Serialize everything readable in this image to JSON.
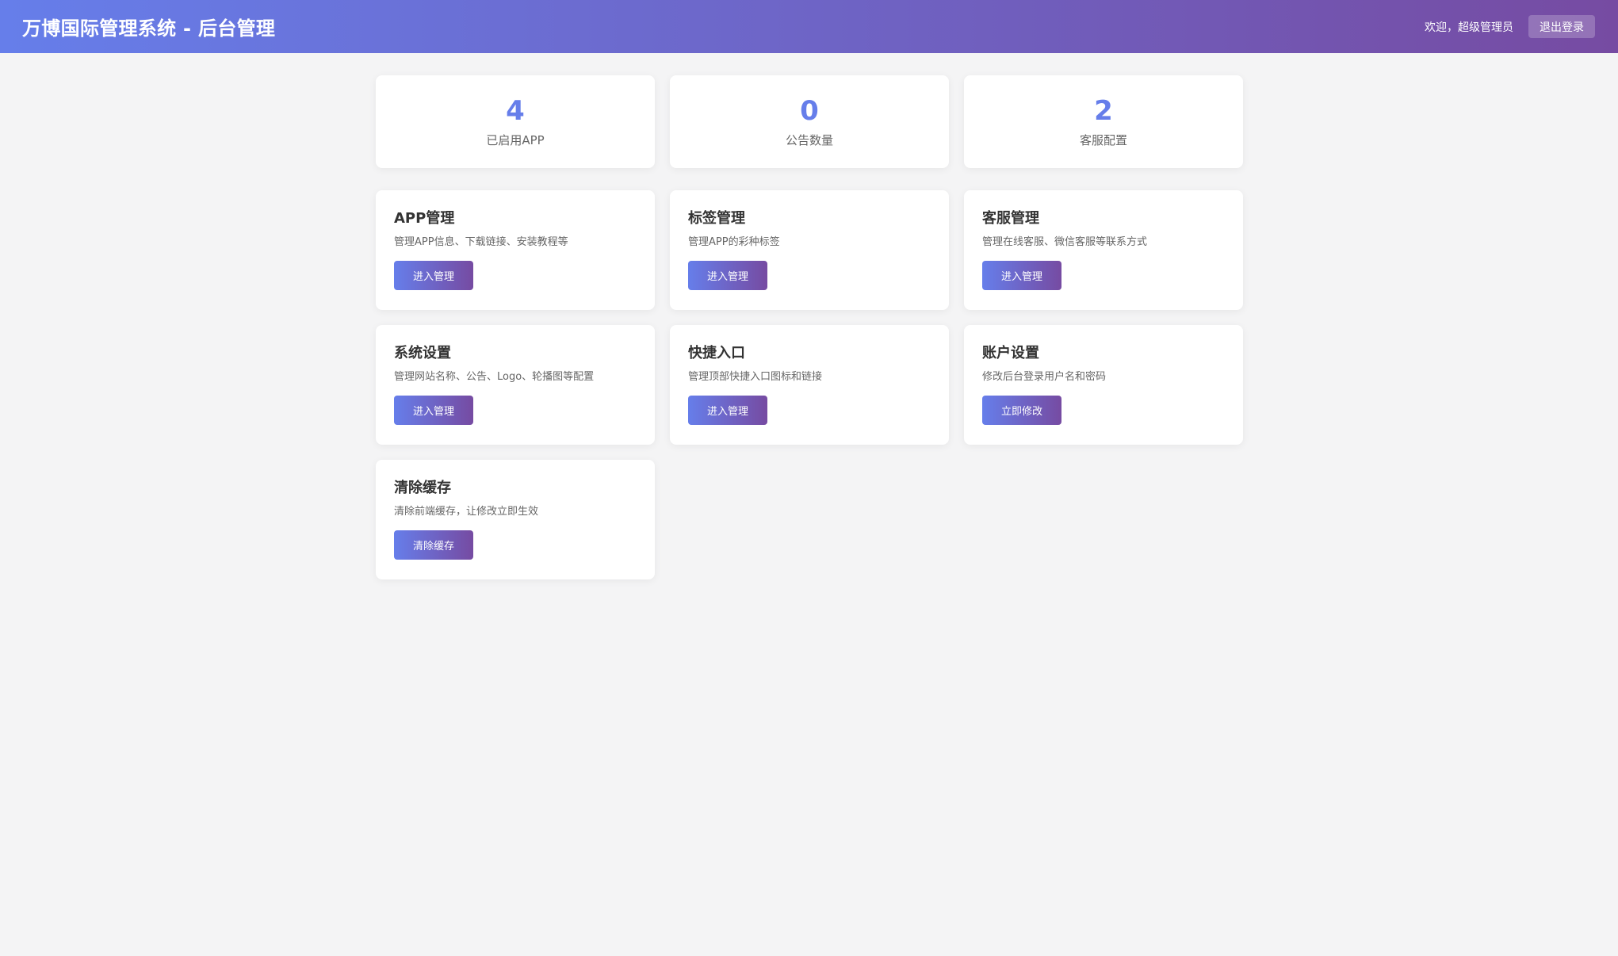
{
  "header": {
    "title": "万博国际管理系统 - 后台管理",
    "welcome": "欢迎，超级管理员",
    "logout_label": "退出登录"
  },
  "stats": [
    {
      "value": "4",
      "label": "已启用APP"
    },
    {
      "value": "0",
      "label": "公告数量"
    },
    {
      "value": "2",
      "label": "客服配置"
    }
  ],
  "modules": [
    {
      "title": "APP管理",
      "desc": "管理APP信息、下载链接、安装教程等",
      "button": "进入管理"
    },
    {
      "title": "标签管理",
      "desc": "管理APP的彩种标签",
      "button": "进入管理"
    },
    {
      "title": "客服管理",
      "desc": "管理在线客服、微信客服等联系方式",
      "button": "进入管理"
    },
    {
      "title": "系统设置",
      "desc": "管理网站名称、公告、Logo、轮播图等配置",
      "button": "进入管理"
    },
    {
      "title": "快捷入口",
      "desc": "管理顶部快捷入口图标和链接",
      "button": "进入管理"
    },
    {
      "title": "账户设置",
      "desc": "修改后台登录用户名和密码",
      "button": "立即修改"
    },
    {
      "title": "清除缓存",
      "desc": "清除前端缓存，让修改立即生效",
      "button": "清除缓存"
    }
  ],
  "colors": {
    "accent_start": "#667eea",
    "accent_end": "#764ba2",
    "background": "#f4f4f5"
  }
}
